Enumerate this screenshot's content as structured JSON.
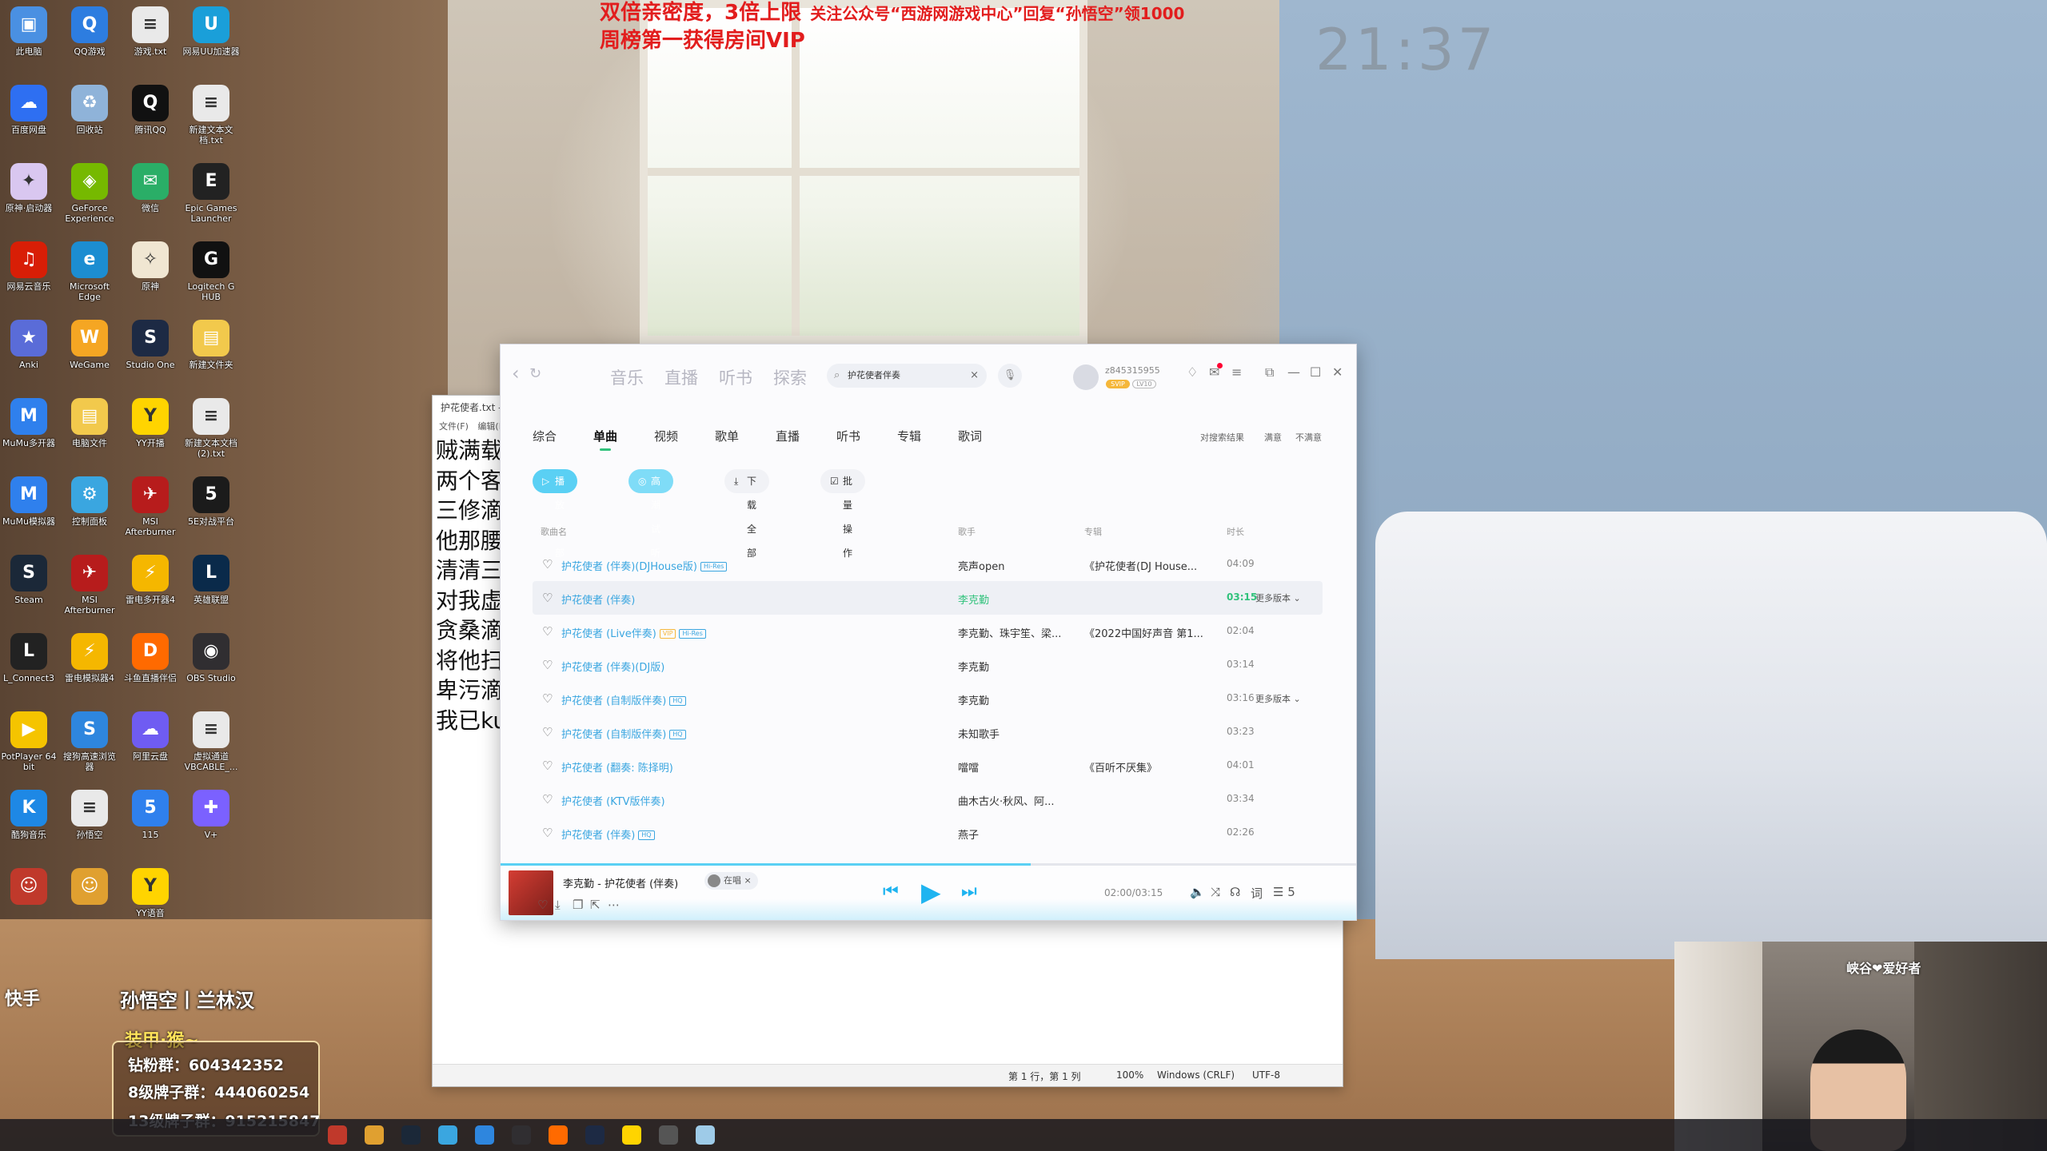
{
  "banner": {
    "line1_big": "双倍亲密度，3倍上限",
    "line1_small": "关注公众号“西游网游戏中心”回复“孙悟空”领1000",
    "line2": "周榜第一获得房间VIP"
  },
  "desktop_clock": "21:37",
  "desktop_icons": [
    {
      "label": "此电脑",
      "color": "#4a90e2",
      "glyph": "▣"
    },
    {
      "label": "QQ游戏",
      "color": "#2d7de0",
      "glyph": "Q"
    },
    {
      "label": "游戏.txt",
      "color": "#e9e9e9",
      "glyph": "≡"
    },
    {
      "label": "网易UU加速器",
      "color": "#1a9fd9",
      "glyph": "U"
    },
    {
      "label": "百度网盘",
      "color": "#2e6ff2",
      "glyph": "☁"
    },
    {
      "label": "回收站",
      "color": "#8fb3d9",
      "glyph": "♻"
    },
    {
      "label": "腾讯QQ",
      "color": "#111111",
      "glyph": "Q"
    },
    {
      "label": "新建文本文档.txt",
      "color": "#e9e9e9",
      "glyph": "≡"
    },
    {
      "label": "原神·启动器",
      "color": "#d9c7f0",
      "glyph": "✦"
    },
    {
      "label": "GeForce Experience",
      "color": "#76b900",
      "glyph": "◈"
    },
    {
      "label": "微信",
      "color": "#2aae67",
      "glyph": "✉"
    },
    {
      "label": "Epic Games Launcher",
      "color": "#222222",
      "glyph": "E"
    },
    {
      "label": "网易云音乐",
      "color": "#d81e06",
      "glyph": "♫"
    },
    {
      "label": "Microsoft Edge",
      "color": "#1c8dd1",
      "glyph": "e"
    },
    {
      "label": "原神",
      "color": "#f0e6d2",
      "glyph": "✧"
    },
    {
      "label": "Logitech G HUB",
      "color": "#111111",
      "glyph": "G"
    },
    {
      "label": "Anki",
      "color": "#5a6cd8",
      "glyph": "★"
    },
    {
      "label": "WeGame",
      "color": "#f5a623",
      "glyph": "W"
    },
    {
      "label": "Studio One",
      "color": "#1d2a44",
      "glyph": "S"
    },
    {
      "label": "新建文件夹",
      "color": "#f2c94c",
      "glyph": "▤"
    },
    {
      "label": "MuMu多开器",
      "color": "#2f80ed",
      "glyph": "M"
    },
    {
      "label": "电脑文件",
      "color": "#f2c94c",
      "glyph": "▤"
    },
    {
      "label": "YY开播",
      "color": "#ffd400",
      "glyph": "Y"
    },
    {
      "label": "新建文本文档 (2).txt",
      "color": "#e9e9e9",
      "glyph": "≡"
    },
    {
      "label": "MuMu模拟器",
      "color": "#2f80ed",
      "glyph": "M"
    },
    {
      "label": "控制面板",
      "color": "#3aa6e0",
      "glyph": "⚙"
    },
    {
      "label": "MSI Afterburner",
      "color": "#b71c1c",
      "glyph": "✈"
    },
    {
      "label": "5E对战平台",
      "color": "#1b1b1b",
      "glyph": "5"
    },
    {
      "label": "Steam",
      "color": "#1b2838",
      "glyph": "S"
    },
    {
      "label": "MSI Afterburner",
      "color": "#b71c1c",
      "glyph": "✈"
    },
    {
      "label": "雷电多开器4",
      "color": "#f5b700",
      "glyph": "⚡"
    },
    {
      "label": "英雄联盟",
      "color": "#0a2a4a",
      "glyph": "L"
    },
    {
      "label": "L_Connect3",
      "color": "#222222",
      "glyph": "L"
    },
    {
      "label": "雷电模拟器4",
      "color": "#f5b700",
      "glyph": "⚡"
    },
    {
      "label": "斗鱼直播伴侣",
      "color": "#ff6a00",
      "glyph": "D"
    },
    {
      "label": "OBS Studio",
      "color": "#302e31",
      "glyph": "◉"
    },
    {
      "label": "PotPlayer 64 bit",
      "color": "#f5c400",
      "glyph": "▶"
    },
    {
      "label": "搜狗高速浏览器",
      "color": "#2e86de",
      "glyph": "S"
    },
    {
      "label": "阿里云盘",
      "color": "#6f5cf2",
      "glyph": "☁"
    },
    {
      "label": "虚拟通道 VBCABLE_...",
      "color": "#e9e9e9",
      "glyph": "≡"
    },
    {
      "label": "酷狗音乐",
      "color": "#1e88e5",
      "glyph": "K"
    },
    {
      "label": "孙悟空",
      "color": "#e9e9e9",
      "glyph": "≡"
    },
    {
      "label": "115",
      "color": "#2f80ed",
      "glyph": "5"
    },
    {
      "label": "V+",
      "color": "#7b61ff",
      "glyph": "✚"
    },
    {
      "label": "",
      "color": "#c0392b",
      "glyph": "☺"
    },
    {
      "label": "",
      "color": "#e0a030",
      "glyph": "☺"
    },
    {
      "label": "YY语音",
      "color": "#ffd400",
      "glyph": "Y"
    }
  ],
  "notepad": {
    "title": "护花使者.txt - 记事本",
    "menu": "文件(F) 编辑(E)",
    "lines": [
      "贼满载",
      "两个客",
      "三修滴",
      "他那腰",
      "清清三",
      "对我虚",
      "贪桑滴",
      "将他扫",
      "卑污滴",
      "我已ku"
    ],
    "status": {
      "pos": "第 1 行，第 1 列",
      "zoom": "100%",
      "eol": "Windows (CRLF)",
      "enc": "UTF-8"
    }
  },
  "music": {
    "nav": [
      "音乐",
      "直播",
      "听书",
      "探索"
    ],
    "search": {
      "value": "护花使者伴奏",
      "icon": "search-icon"
    },
    "user": {
      "name": "z845315955",
      "badge": "SVIP",
      "level": "LV10"
    },
    "tabs": [
      "综合",
      "单曲",
      "视频",
      "歌单",
      "直播",
      "听书",
      "专辑",
      "歌词"
    ],
    "active_tab": 1,
    "tab_right": [
      "对搜索结果",
      "满意",
      "不满意"
    ],
    "actions": [
      {
        "label": "播放全部",
        "icon": "▷"
      },
      {
        "label": "高潮试听",
        "icon": "◎"
      },
      {
        "label": "下载全部",
        "icon": "⤓"
      },
      {
        "label": "批量操作",
        "icon": "☑"
      }
    ],
    "columns": {
      "title": "歌曲名",
      "artist": "歌手",
      "album": "专辑",
      "duration": "时长"
    },
    "songs": [
      {
        "title": "护花使者 (伴奏)(DJHouse版)",
        "tags": [
          "Hi-Res"
        ],
        "artist": "亮声open",
        "album": "《护花使者(DJ House...",
        "duration": "04:09",
        "more": ""
      },
      {
        "title": "护花使者 (伴奏)",
        "tags": [],
        "artist": "李克勤",
        "album": "",
        "duration": "03:15",
        "more": "更多版本"
      },
      {
        "title": "护花使者 (Live伴奏)",
        "tags": [
          "VIP",
          "Hi-Res"
        ],
        "artist": "李克勤、珠宇笙、梁...",
        "album": "《2022中国好声音 第1...",
        "duration": "02:04",
        "more": ""
      },
      {
        "title": "护花使者 (伴奏)(DJ版)",
        "tags": [],
        "artist": "李克勤",
        "album": "",
        "duration": "03:14",
        "more": ""
      },
      {
        "title": "护花使者 (自制版伴奏)",
        "tags": [
          "HQ"
        ],
        "artist": "李克勤",
        "album": "",
        "duration": "03:16",
        "more": "更多版本"
      },
      {
        "title": "护花使者 (自制版伴奏)",
        "tags": [
          "HQ"
        ],
        "artist": "未知歌手",
        "album": "",
        "duration": "03:23",
        "more": ""
      },
      {
        "title": "护花使者 (翻奏: 陈择明)",
        "tags": [],
        "artist": "噹噹",
        "album": "《百听不厌集》",
        "duration": "04:01",
        "more": ""
      },
      {
        "title": "护花使者 (KTV版伴奏)",
        "tags": [],
        "artist": "曲木古火·秋风、阿...",
        "album": "",
        "duration": "03:34",
        "more": ""
      },
      {
        "title": "护花使者 (伴奏)",
        "tags": [
          "HQ"
        ],
        "artist": "燕子",
        "album": "",
        "duration": "02:26",
        "more": ""
      }
    ],
    "player": {
      "title": "李克勤 - 护花使者 (伴奏)",
      "chip": "在唱",
      "time": "02:00/03:15",
      "progress_fraction": 0.62,
      "queue_count": "5"
    }
  },
  "overlay": {
    "kuaishou": "快手",
    "streamer": "孙悟空丨兰林汉",
    "fan_head": "装甲·猴~",
    "fan_lines": [
      "钻粉群：604342352",
      "8级牌子群：444060254",
      "13级牌子群：915215847"
    ],
    "webcam_caption": "峡谷❤爱好者"
  }
}
